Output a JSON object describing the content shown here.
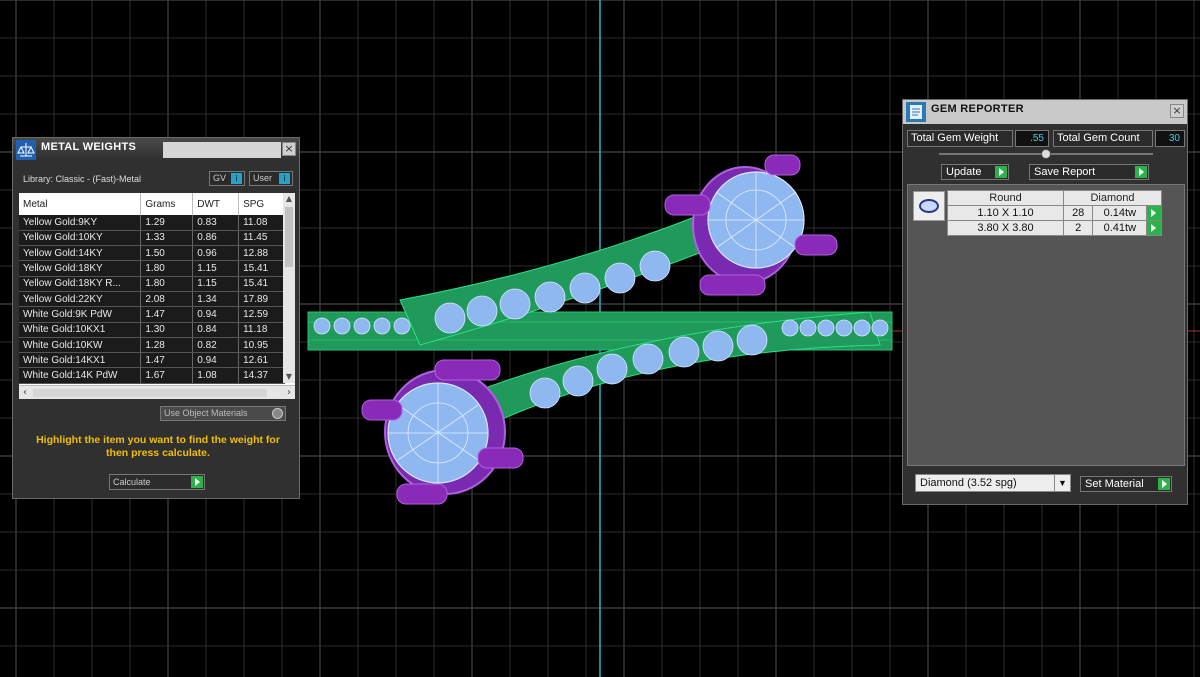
{
  "metal_weights": {
    "title": "METAL WEIGHTS",
    "library": "Library: Classic - (Fast)-Metal",
    "gv_label": "GV",
    "user_label": "User",
    "columns": [
      "Metal",
      "Grams",
      "DWT",
      "SPG"
    ],
    "rows": [
      [
        "Yellow Gold:9KY",
        "1.29",
        "0.83",
        "11.08"
      ],
      [
        "Yellow Gold:10KY",
        "1.33",
        "0.86",
        "11.45"
      ],
      [
        "Yellow Gold:14KY",
        "1.50",
        "0.96",
        "12.88"
      ],
      [
        "Yellow Gold:18KY",
        "1.80",
        "1.15",
        "15.41"
      ],
      [
        "Yellow Gold:18KY R...",
        "1.80",
        "1.15",
        "15.41"
      ],
      [
        "Yellow Gold:22KY",
        "2.08",
        "1.34",
        "17.89"
      ],
      [
        "White Gold:9K PdW",
        "1.47",
        "0.94",
        "12.59"
      ],
      [
        "White Gold:10KX1",
        "1.30",
        "0.84",
        "11.18"
      ],
      [
        "White Gold:10KW",
        "1.28",
        "0.82",
        "10.95"
      ],
      [
        "White Gold:14KX1",
        "1.47",
        "0.94",
        "12.61"
      ],
      [
        "White Gold:14K PdW",
        "1.67",
        "1.08",
        "14.37"
      ]
    ],
    "use_object_materials": "Use Object Materials",
    "hint": "Highlight the item you want to find the weight for then press calculate.",
    "calculate_label": "Calculate"
  },
  "gem_reporter": {
    "title": "GEM REPORTER",
    "total_weight_label": "Total Gem Weight",
    "total_weight_value": ".55",
    "total_count_label": "Total Gem Count",
    "total_count_value": "30",
    "update_label": "Update",
    "save_report_label": "Save Report",
    "table_headers": [
      "Round",
      "Diamond"
    ],
    "rows": [
      [
        "1.10 X 1.10",
        "28",
        "0.14tw"
      ],
      [
        "3.80 X 3.80",
        "2",
        "0.41tw"
      ]
    ],
    "material_selected": "Diamond      (3.52 spg)",
    "set_material_label": "Set Material"
  },
  "colors": {
    "grid": "#3a3a3a",
    "axis_vertical": "#1fb5c8",
    "band_green": "#1f9a5a",
    "stone_blue": "#8fb8f0",
    "prong_purple": "#8a2ab8",
    "hint_yellow": "#f0c000",
    "go_green": "#2bb34a"
  }
}
